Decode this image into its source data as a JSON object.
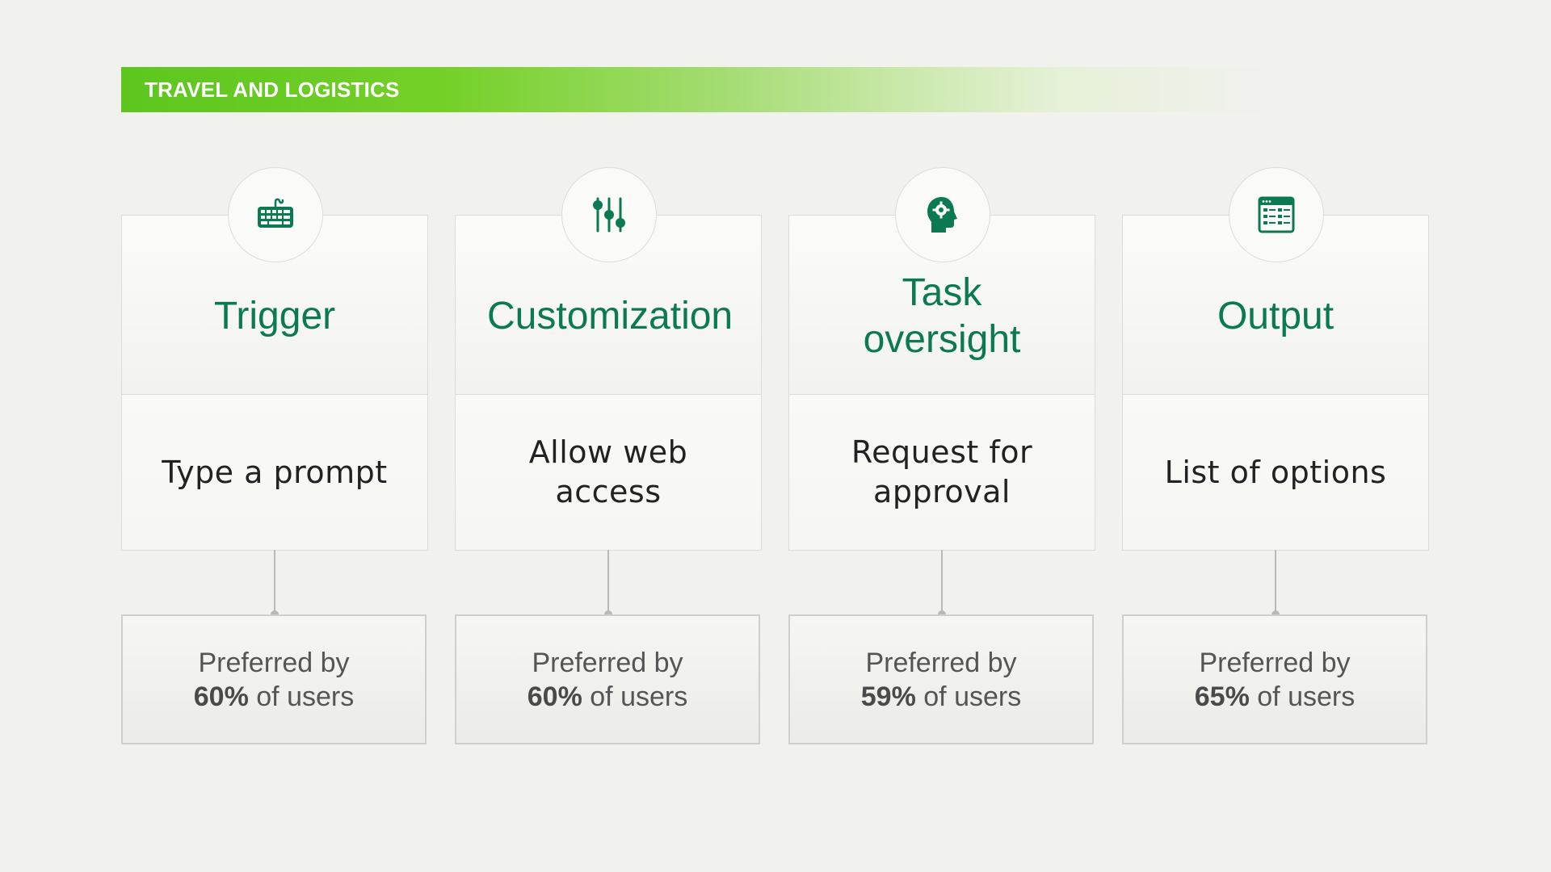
{
  "banner": {
    "label": "TRAVEL AND LOGISTICS"
  },
  "colors": {
    "accent_green": "#0b7a50",
    "banner_green": "#5cc61f"
  },
  "columns": [
    {
      "icon": "keyboard-icon",
      "title": "Trigger",
      "action": "Type a prompt",
      "stat_prefix": "Preferred by",
      "stat_value": "60%",
      "stat_suffix": " of users"
    },
    {
      "icon": "sliders-icon",
      "title": "Customization",
      "action": "Allow web access",
      "stat_prefix": "Preferred by",
      "stat_value": "60%",
      "stat_suffix": " of users"
    },
    {
      "icon": "head-gear-icon",
      "title": "Task oversight",
      "action": "Request for approval",
      "stat_prefix": "Preferred by",
      "stat_value": "59%",
      "stat_suffix": " of users"
    },
    {
      "icon": "list-window-icon",
      "title": "Output",
      "action": "List of options",
      "stat_prefix": "Preferred by",
      "stat_value": "65%",
      "stat_suffix": " of users"
    }
  ]
}
